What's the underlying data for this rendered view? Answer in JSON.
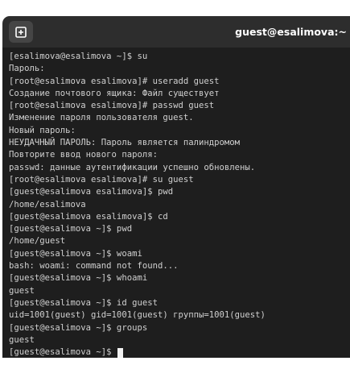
{
  "window": {
    "title": "guest@esalimova:~"
  },
  "terminal": {
    "lines": [
      "[esalimova@esalimova ~]$ su",
      "Пароль:",
      "[root@esalimova esalimova]# useradd guest",
      "Создание почтового ящика: Файл существует",
      "[root@esalimova esalimova]# passwd guest",
      "Изменение пароля пользователя guest.",
      "Новый пароль:",
      "НЕУДАЧНЫЙ ПАРОЛЬ: Пароль является палиндромом",
      "Повторите ввод нового пароля:",
      "passwd: данные аутентификации успешно обновлены.",
      "[root@esalimova esalimova]# su guest",
      "[guest@esalimova esalimova]$ pwd",
      "/home/esalimova",
      "[guest@esalimova esalimova]$ cd",
      "[guest@esalimova ~]$ pwd",
      "/home/guest",
      "[guest@esalimova ~]$ woami",
      "bash: woami: command not found...",
      "[guest@esalimova ~]$ whoami",
      "guest",
      "[guest@esalimova ~]$ id guest",
      "uid=1001(guest) gid=1001(guest) группы=1001(guest)",
      "[guest@esalimova ~]$ groups",
      "guest"
    ],
    "prompt": "[guest@esalimova ~]$ "
  },
  "icons": {
    "new_tab": "new-tab-icon"
  },
  "colors": {
    "titlebar": "#2d2d2d",
    "terminal_bg": "#1e1e1e",
    "text": "#d0d0d0",
    "cursor": "#f2f2f2"
  }
}
